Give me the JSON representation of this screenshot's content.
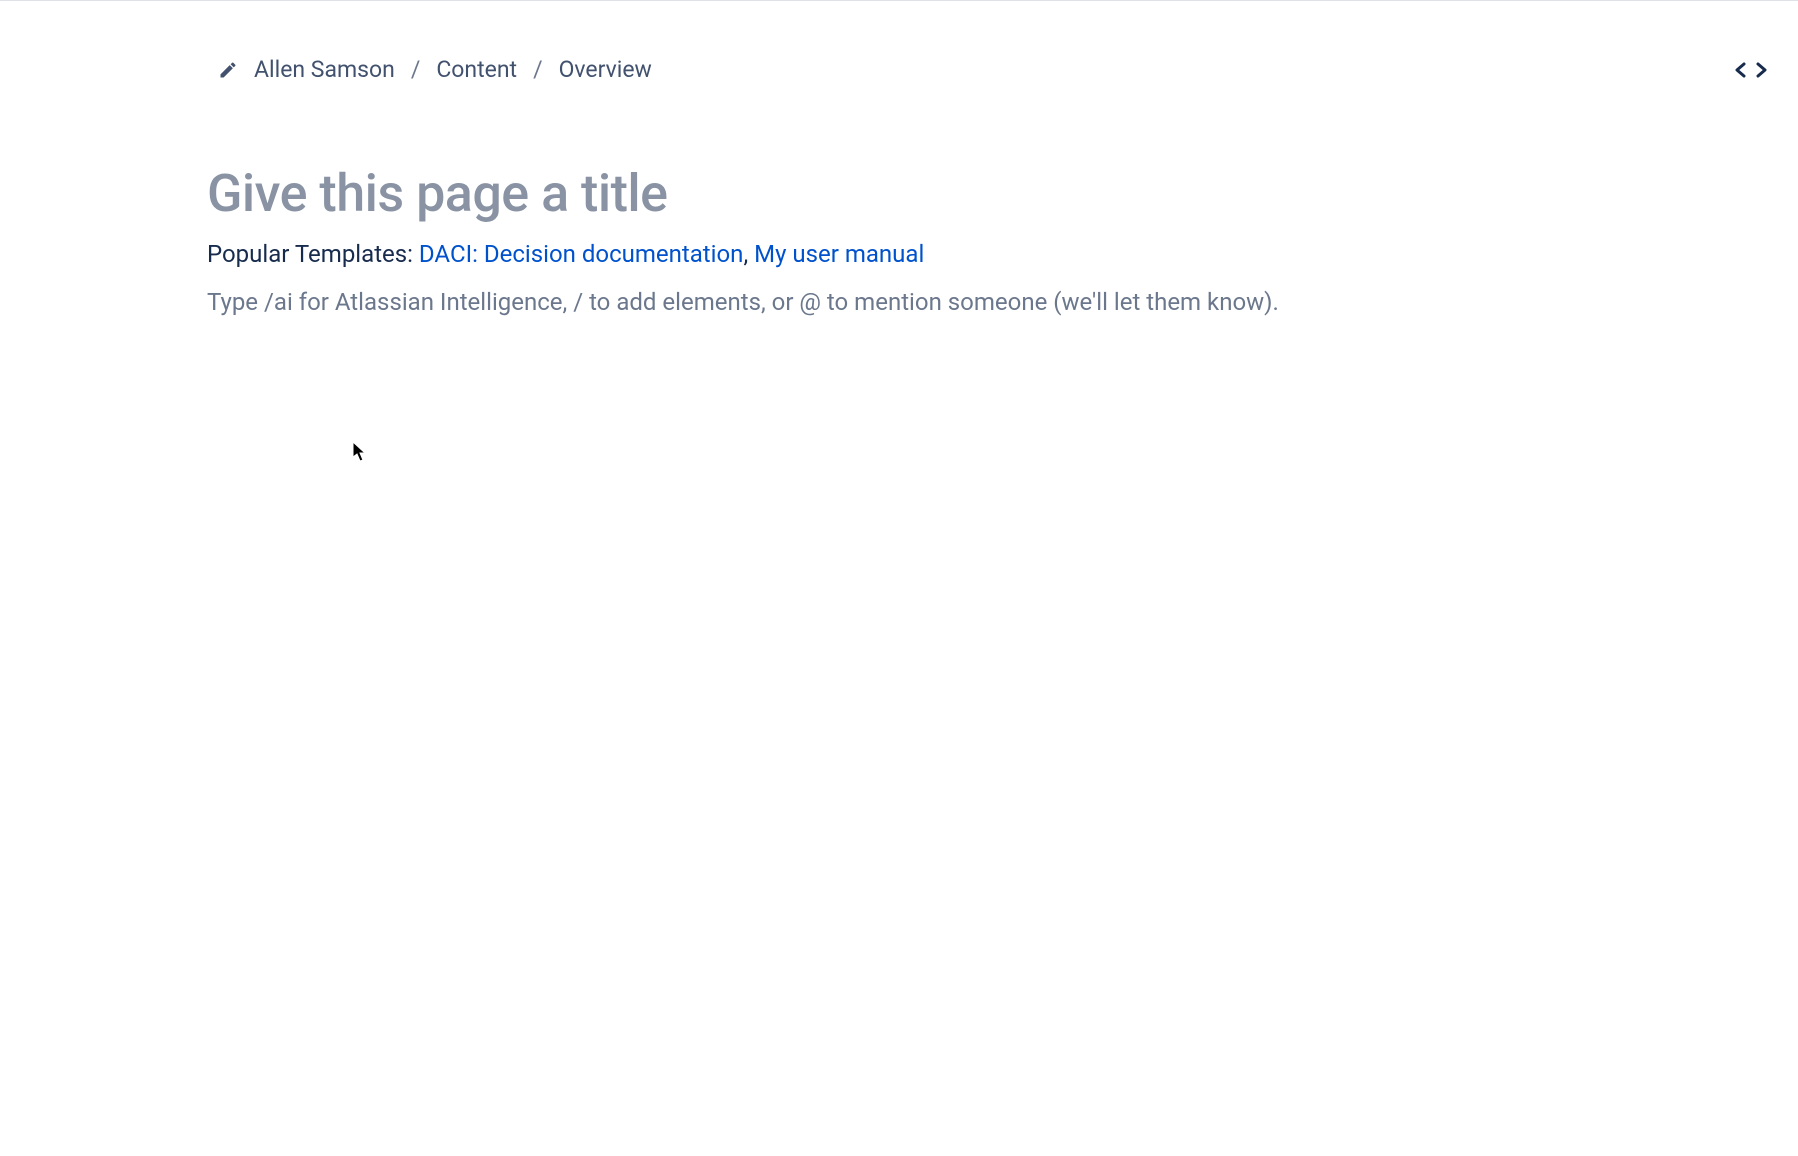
{
  "breadcrumb": {
    "items": [
      {
        "label": "Allen Samson"
      },
      {
        "label": "Content"
      },
      {
        "label": "Overview"
      }
    ],
    "separator": "/"
  },
  "title_placeholder": "Give this page a title",
  "templates": {
    "prefix": "Popular Templates: ",
    "links": [
      {
        "label": "DACI: Decision documentation"
      },
      {
        "label": "My user manual"
      }
    ],
    "separator": ", "
  },
  "body_placeholder": "Type /ai for Atlassian Intelligence, / to add elements, or @ to mention someone (we'll let them know)."
}
